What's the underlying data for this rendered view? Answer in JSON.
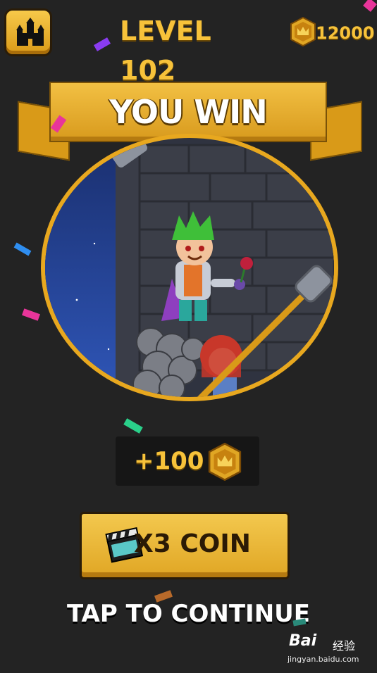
{
  "header": {
    "level_label": "LEVEL 102",
    "coins": "12000",
    "home_icon": "castle-icon",
    "coin_icon": "crown-coin-icon"
  },
  "banner": {
    "title": "YOU WIN"
  },
  "reward": {
    "amount": "+100"
  },
  "actions": {
    "multiplier_label": "X3 COIN",
    "multiplier_icon": "clapperboard-icon",
    "continue_label": "TAP TO CONTINUE"
  },
  "watermark": {
    "brand": "Bai",
    "brand_cn": "经验",
    "url": "jingyan.baidu.com"
  },
  "colors": {
    "accent_gold": "#f7c23a",
    "button_gold": "#e0a624",
    "background": "#232323"
  }
}
